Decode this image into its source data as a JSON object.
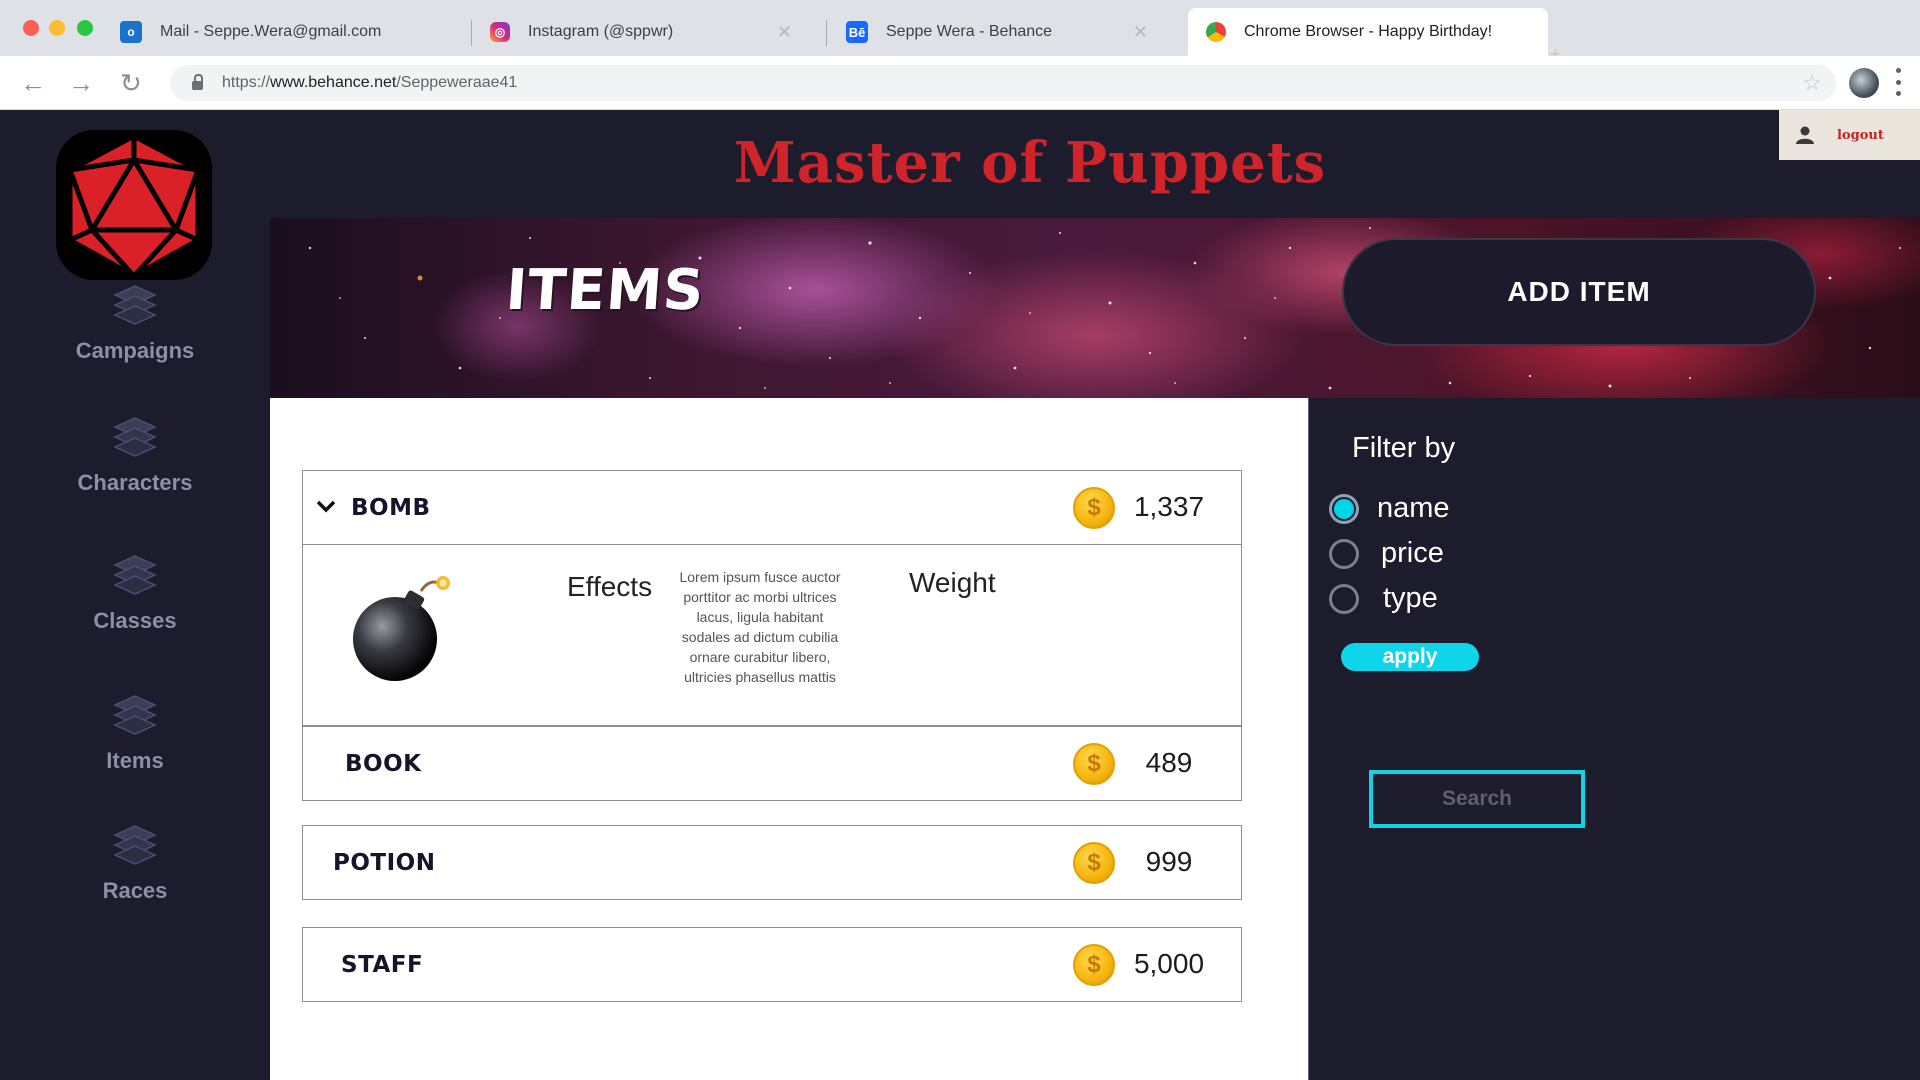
{
  "browser": {
    "tabs": [
      {
        "label": "Mail - Seppe.Wera@gmail.com",
        "icon": "outlook-icon"
      },
      {
        "label": "Instagram (@sppwr)",
        "icon": "instagram-icon"
      },
      {
        "label": "Seppe Wera - Behance",
        "icon": "behance-icon"
      },
      {
        "label": "Chrome Browser - Happy Birthday!",
        "icon": "chrome-icon"
      }
    ],
    "url_prefix": "https://",
    "url_domain": "www.behance.net",
    "url_path": "/Seppeweraae41"
  },
  "app": {
    "title": "Master of Puppets",
    "logout_label": "logout",
    "banner_title": "ITEMS",
    "add_item_label": "ADD ITEM",
    "sidebar": [
      {
        "label": "Campaigns",
        "icon": "stack-icon"
      },
      {
        "label": "Characters",
        "icon": "stack-icon"
      },
      {
        "label": "Classes",
        "icon": "stack-icon"
      },
      {
        "label": "Items",
        "icon": "stack-icon"
      },
      {
        "label": "Races",
        "icon": "stack-icon"
      }
    ],
    "items": [
      {
        "name": "BOMB",
        "price": "1,337",
        "expanded": true
      },
      {
        "name": "BOOK",
        "price": "489"
      },
      {
        "name": "POTION",
        "price": "999"
      },
      {
        "name": "STAFF",
        "price": "5,000"
      }
    ],
    "detail": {
      "effects_label": "Effects",
      "weight_label": "Weight",
      "description": "Lorem ipsum fusce auctor porttitor ac morbi ultrices lacus, ligula habitant sodales ad dictum cubilia ornare curabitur libero, ultricies phasellus mattis"
    },
    "filter": {
      "title": "Filter by",
      "options": [
        "name",
        "price",
        "type"
      ],
      "selected": "name",
      "apply_label": "apply",
      "search_placeholder": "Search"
    },
    "colors": {
      "background": "#1c1c2c",
      "title_red": "#d0242b",
      "accent_cyan": "#0fd5ea",
      "coin_gold": "#f4b10b"
    }
  }
}
